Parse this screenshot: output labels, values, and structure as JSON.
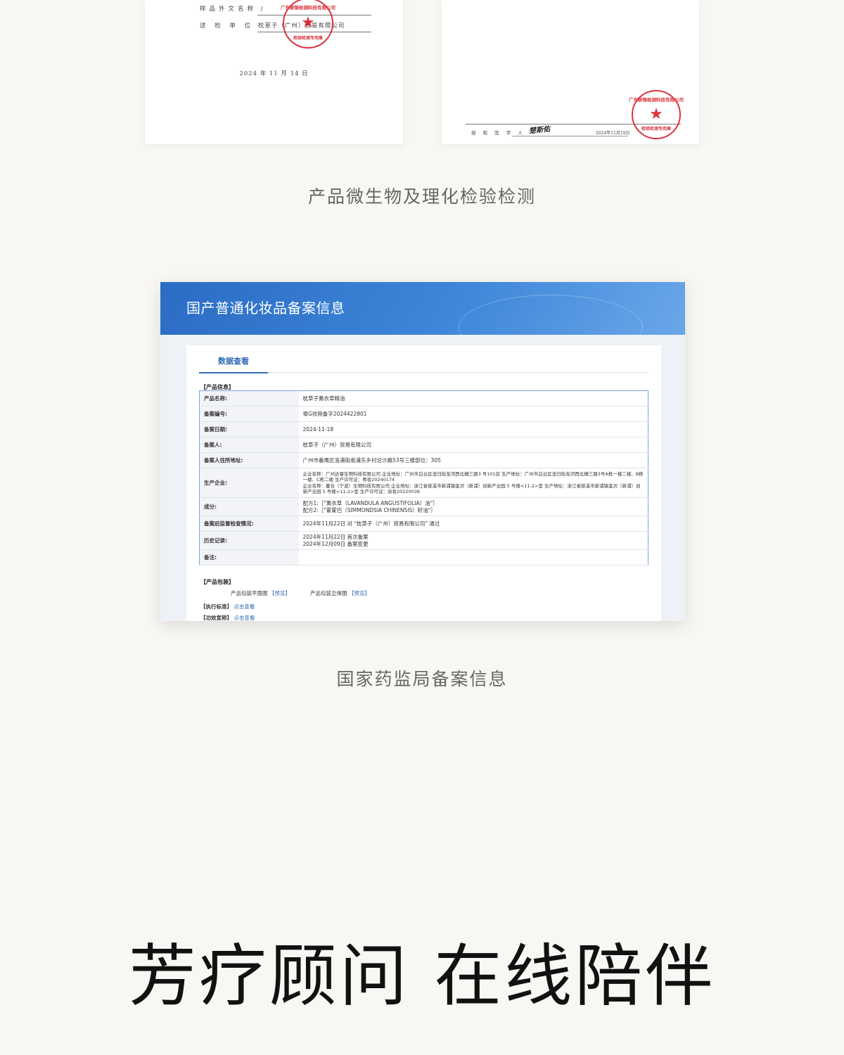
{
  "report_left": {
    "sample_foreign_name_label": "样品外文名称",
    "sample_foreign_name_value": "/",
    "sender_label": "送 检 单 位",
    "sender_value": "枕草子（广州）贸易有限公司",
    "date": "2024 年 11 月 14 日",
    "stamp_top": "广东联锦检测科技有限公司",
    "stamp_bottom": "检验检测专用章"
  },
  "report_right": {
    "signer_label": "授 权 签 字 人",
    "signature": "楚斯佑",
    "date": "2024年11月18日",
    "stamp_top": "广东联锦检测科技有限公司",
    "stamp_bottom": "检验检测专用章"
  },
  "caption_1": "产品微生物及理化检验检测",
  "registry": {
    "title": "国产普通化妆品备案信息",
    "tab": "数据查看",
    "section_product": "【产品信息】",
    "rows": [
      {
        "key": "产品名称:",
        "value": "枕草子薰衣草精油"
      },
      {
        "key": "备案编号:",
        "value": "粤G妆网备字2024422801"
      },
      {
        "key": "备案日期:",
        "value": "2024-11-18"
      },
      {
        "key": "备案人:",
        "value": "枕草子（广州）贸易有限公司"
      },
      {
        "key": "备案人住所地址:",
        "value": "广州市番禺区洛浦街南浦东乡村沿沙路53号三楼部位：305"
      },
      {
        "key": "生产企业:",
        "value": "企业名称：广州达睿生物科技有限公司 企业地址：广州市白云区龙归街龙河西北横三路3 号101房 生产地址：广州市白云区龙归街龙河西北横三路3号A栋一楼二楼、B栋一楼、C栋二楼 生产许可证：粤妆20240174\n企业名称：蔓合（宁波）生物科技有限公司 企业地址：浙江省慈溪市新浦镇金沢（新浦）创新产业园 5 号楼<11-2>室 生产地址：浙江省慈溪市新浦镇金沢（新浦）创新产业园 5 号楼<11-2>室 生产许可证：浙妆20220036"
      },
      {
        "key": "成分:",
        "value": "配方1:［\"薰衣草（LAVANDULA ANGUSTIFOLIA）油\"］\n配方2:［\"霍霍巴（SIMMONDSIA CHINENSIS）籽油\"］"
      },
      {
        "key": "备案后监督检查情况:",
        "value": "2024年11月22日 对 \"枕草子（广州）贸易有限公司\" 通过"
      },
      {
        "key": "历史记录:",
        "value": "2024年11月22日 首次备案\n2024年12月09日 备案变更"
      },
      {
        "key": "备注:",
        "value": ""
      }
    ],
    "section_package": "【产品包装】",
    "package_flat": "产品包装平面图",
    "package_3d": "产品包装立体图",
    "preview": "【预览】",
    "standard_label": "【执行标准】",
    "claim_label": "【功效宣称】",
    "view_link": "点击查看"
  },
  "caption_2": "国家药监局备案信息",
  "slogan": "芳疗顾问 在线陪伴",
  "colors": {
    "background": "#f8f7f3",
    "stamp_red": "#d9232e",
    "banner_blue": "#2b6cc4",
    "link_blue": "#2f6bb7"
  }
}
